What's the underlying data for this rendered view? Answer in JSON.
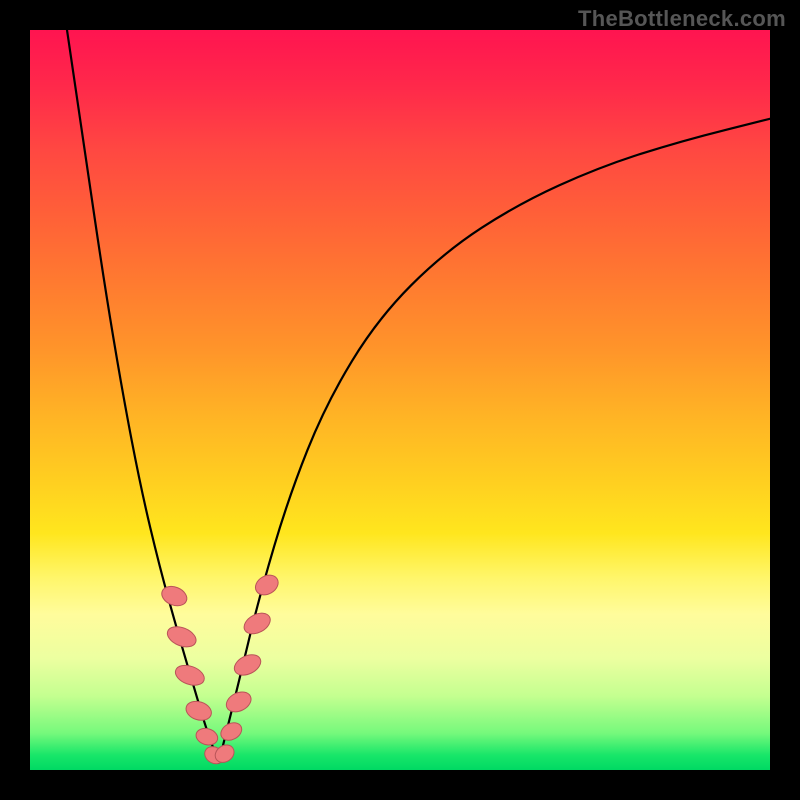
{
  "watermark": "TheBottleneck.com",
  "colors": {
    "frame_bg": "#000000",
    "gradient_top": "#ff1450",
    "gradient_mid": "#ffcf20",
    "gradient_low": "#fffc9c",
    "gradient_bottom": "#00d963",
    "curve_stroke": "#000000",
    "bead_fill": "#ef7a7c",
    "bead_stroke": "#b95458"
  },
  "chart_data": {
    "type": "line",
    "title": "",
    "xlabel": "",
    "ylabel": "",
    "x_range": [
      0,
      1
    ],
    "y_range": [
      0,
      1
    ],
    "note": "Axes are unlabeled; x and y are normalized 0–1 within the colored plot area (origin bottom-left). Curve is a V-shaped dip reaching ~0 at x≈0.255.",
    "series": [
      {
        "name": "left-branch",
        "x": [
          0.05,
          0.075,
          0.1,
          0.125,
          0.15,
          0.175,
          0.2,
          0.225,
          0.24,
          0.255
        ],
        "y": [
          1.0,
          0.83,
          0.66,
          0.51,
          0.38,
          0.275,
          0.185,
          0.1,
          0.05,
          0.01
        ]
      },
      {
        "name": "right-branch",
        "x": [
          0.255,
          0.28,
          0.31,
          0.35,
          0.4,
          0.47,
          0.56,
          0.66,
          0.77,
          0.88,
          1.0
        ],
        "y": [
          0.01,
          0.11,
          0.235,
          0.37,
          0.495,
          0.61,
          0.7,
          0.765,
          0.815,
          0.85,
          0.88
        ]
      }
    ],
    "beads_note": "Pink oval markers clustered near the bottom of the V on both branches.",
    "beads": [
      {
        "branch": "left",
        "x": 0.195,
        "y": 0.235,
        "rx": 9,
        "ry": 13,
        "rot": -68
      },
      {
        "branch": "left",
        "x": 0.205,
        "y": 0.18,
        "rx": 9,
        "ry": 15,
        "rot": -68
      },
      {
        "branch": "left",
        "x": 0.216,
        "y": 0.128,
        "rx": 9,
        "ry": 15,
        "rot": -70
      },
      {
        "branch": "left",
        "x": 0.228,
        "y": 0.08,
        "rx": 9,
        "ry": 13,
        "rot": -72
      },
      {
        "branch": "left",
        "x": 0.239,
        "y": 0.045,
        "rx": 8,
        "ry": 11,
        "rot": -74
      },
      {
        "branch": "left",
        "x": 0.249,
        "y": 0.02,
        "rx": 8,
        "ry": 10,
        "rot": -60
      },
      {
        "branch": "right",
        "x": 0.263,
        "y": 0.022,
        "rx": 8,
        "ry": 10,
        "rot": 55
      },
      {
        "branch": "right",
        "x": 0.272,
        "y": 0.052,
        "rx": 8,
        "ry": 11,
        "rot": 62
      },
      {
        "branch": "right",
        "x": 0.282,
        "y": 0.092,
        "rx": 9,
        "ry": 13,
        "rot": 64
      },
      {
        "branch": "right",
        "x": 0.294,
        "y": 0.142,
        "rx": 9,
        "ry": 14,
        "rot": 64
      },
      {
        "branch": "right",
        "x": 0.307,
        "y": 0.198,
        "rx": 9,
        "ry": 14,
        "rot": 62
      },
      {
        "branch": "right",
        "x": 0.32,
        "y": 0.25,
        "rx": 9,
        "ry": 12,
        "rot": 60
      }
    ]
  }
}
